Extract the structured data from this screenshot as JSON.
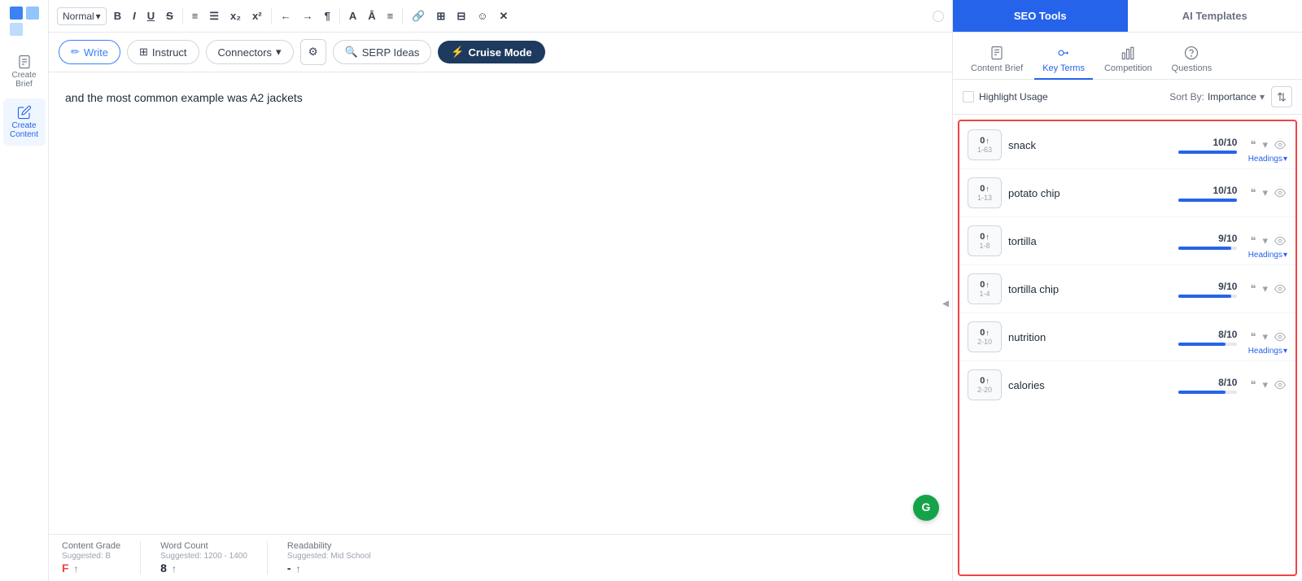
{
  "sidebar": {
    "items": [
      {
        "label": "Create Brief",
        "icon": "file-icon"
      },
      {
        "label": "Create Content",
        "icon": "edit-icon",
        "active": true
      }
    ]
  },
  "toolbar": {
    "format_select": "Normal",
    "buttons": [
      "B",
      "I",
      "U",
      "S",
      "ol",
      "ul",
      "x₂",
      "x²",
      "←",
      "→",
      "¶",
      "A",
      "Ā",
      "≡",
      "🔗",
      "⊞",
      "⊟",
      "☺",
      "✕"
    ]
  },
  "action_bar": {
    "write_label": "Write",
    "instruct_label": "Instruct",
    "connectors_label": "Connectors",
    "settings_label": "⚙",
    "serp_label": "SERP Ideas",
    "cruise_label": "Cruise Mode"
  },
  "editor": {
    "content": "and the most common example was A2 jackets"
  },
  "footer": {
    "grade_label": "Content Grade",
    "grade_suggested": "Suggested: B",
    "grade_value": "F",
    "word_count_label": "Word Count",
    "word_count_suggested": "Suggested: 1200 - 1400",
    "word_count_value": "8",
    "readability_label": "Readability",
    "readability_suggested": "Suggested: Mid School",
    "readability_value": "-"
  },
  "panel": {
    "seo_tools_label": "SEO Tools",
    "ai_templates_label": "AI Templates",
    "tabs": [
      {
        "label": "Content Brief",
        "icon": "brief-icon"
      },
      {
        "label": "Key Terms",
        "icon": "key-icon",
        "active": true
      },
      {
        "label": "Competition",
        "icon": "bar-icon"
      },
      {
        "label": "Questions",
        "icon": "help-icon"
      }
    ],
    "highlight_usage_label": "Highlight Usage",
    "sort_by_label": "Sort By:",
    "sort_value": "Importance",
    "terms": [
      {
        "count": "0",
        "arrow": "↑",
        "range": "1-63",
        "name": "snack",
        "score": "10/10",
        "bar_pct": 100,
        "headings": true
      },
      {
        "count": "0",
        "arrow": "↑",
        "range": "1-13",
        "name": "potato chip",
        "score": "10/10",
        "bar_pct": 100,
        "headings": false
      },
      {
        "count": "0",
        "arrow": "↑",
        "range": "1-8",
        "name": "tortilla",
        "score": "9/10",
        "bar_pct": 90,
        "headings": true
      },
      {
        "count": "0",
        "arrow": "↑",
        "range": "1-4",
        "name": "tortilla chip",
        "score": "9/10",
        "bar_pct": 90,
        "headings": false
      },
      {
        "count": "0",
        "arrow": "↑",
        "range": "2-10",
        "name": "nutrition",
        "score": "8/10",
        "bar_pct": 80,
        "headings": true
      },
      {
        "count": "0",
        "arrow": "↑",
        "range": "2-20",
        "name": "calories",
        "score": "8/10",
        "bar_pct": 80,
        "headings": false
      }
    ],
    "headings_label": "Headings"
  }
}
